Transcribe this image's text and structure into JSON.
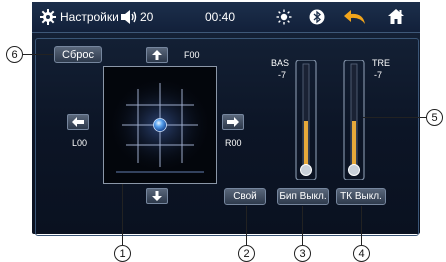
{
  "status_bar": {
    "title": "Настройки",
    "volume": "20",
    "time": "00:40",
    "icons": [
      "gear-icon",
      "speaker-icon",
      "sun-icon",
      "bluetooth-icon",
      "back-arrow-icon",
      "home-icon"
    ],
    "colors": {
      "accent": "#f2a51b",
      "text": "#ffffff"
    }
  },
  "fader": {
    "reset_label": "Сброс",
    "front_label": "F00",
    "left_label": "L00",
    "right_label": "R00",
    "up_icon": "arrow-up-icon",
    "down_icon": "arrow-down-icon",
    "left_icon": "arrow-left-icon",
    "right_icon": "arrow-right-icon"
  },
  "eq": {
    "bass_label": "BAS",
    "bass_value": "-7",
    "treble_label": "TRE",
    "treble_value": "-7",
    "bass_level": 0.45,
    "treble_level": 0.45
  },
  "buttons": {
    "custom_label": "Свой",
    "beep_label": "Бип Выкл.",
    "tk_label": "ТК Выкл."
  },
  "callouts": {
    "c1": "1",
    "c2": "2",
    "c3": "3",
    "c4": "4",
    "c5": "5",
    "c6": "6"
  }
}
